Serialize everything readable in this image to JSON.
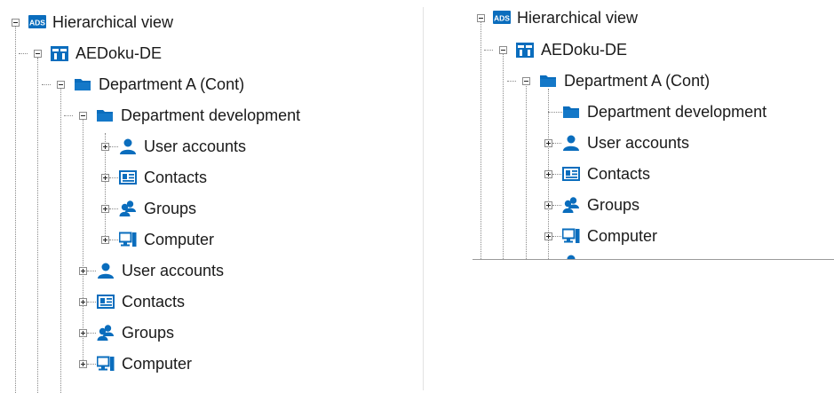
{
  "colors": {
    "icon_blue": "#0a6dbd",
    "folder_blue": "#1478c8",
    "text": "#1a1a1a",
    "tree_line": "#8a8a8a"
  },
  "left_tree": {
    "root": "Hierarchical view",
    "domain": "AEDoku-DE",
    "ou": "Department A (Cont)",
    "sub_ou": "Department development",
    "sub_items": [
      "User accounts",
      "Contacts",
      "Groups",
      "Computer"
    ],
    "items": [
      "User accounts",
      "Contacts",
      "Groups",
      "Computer"
    ]
  },
  "right_tree": {
    "root": "Hierarchical view",
    "domain": "AEDoku-DE",
    "ou": "Department A (Cont)",
    "sub_ou": "Department development",
    "items": [
      "User accounts",
      "Contacts",
      "Groups",
      "Computer"
    ]
  },
  "icons": {
    "root": "ads-icon",
    "domain": "domain-icon",
    "ou": "folder-icon",
    "user": "user-icon",
    "contact": "contact-card-icon",
    "group": "group-icon",
    "computer": "computer-icon"
  }
}
